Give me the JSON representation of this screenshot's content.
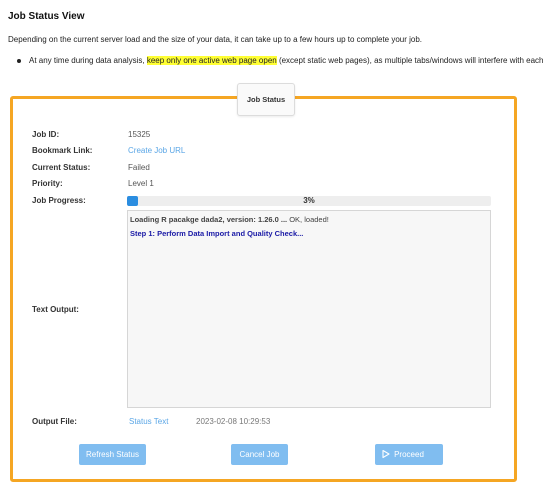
{
  "page": {
    "title": "Job Status View",
    "intro": "Depending on the current server load and the size of your data, it can take up to a few hours up to complete your job.",
    "bullet": {
      "before": "At any time during data analysis, ",
      "highlight": "keep only one active web page open",
      "after": " (except static web pages), as multiple tabs/windows will interfere with each other, le"
    }
  },
  "panel": {
    "tab_label": "Job Status",
    "fields": {
      "job_id_label": "Job ID:",
      "job_id": "15325",
      "bookmark_label": "Bookmark Link:",
      "bookmark_link": "Create Job URL",
      "status_label": "Current Status:",
      "status": "Failed",
      "priority_label": "Priority:",
      "priority": "Level 1",
      "progress_label": "Job Progress:",
      "progress_text": "3%",
      "progress_value": 0.03,
      "text_output_label": "Text Output:",
      "output_file_label": "Output File:",
      "output_file_link": "Status Text",
      "output_file_time": "2023-02-08 10:29:53"
    },
    "output": {
      "line1_bold": "Loading R pacakge dada2, version: 1.26.0 ...",
      "line1_rest": " OK, loaded!",
      "line2": "Step 1: Perform Data Import and Quality Check..."
    },
    "buttons": {
      "refresh": "Refresh Status",
      "cancel": "Cancel Job",
      "proceed": "Proceed"
    }
  },
  "colors": {
    "panel_border": "#f5a623",
    "highlight": "#ffff33",
    "button": "#80bdf0",
    "progress": "#2b8de0",
    "link": "#5aa6e6"
  },
  "icons": {
    "proceed": "play-icon"
  }
}
